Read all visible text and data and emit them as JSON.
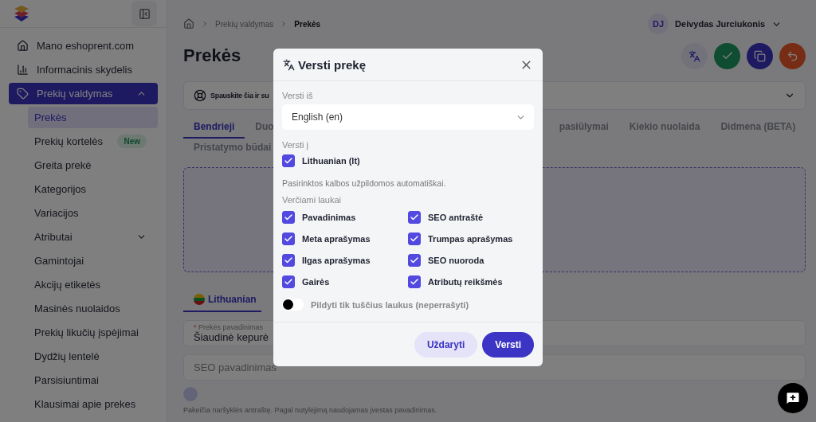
{
  "sidebar": {
    "items": [
      {
        "label": "Mano eshoprent.com",
        "selected": false,
        "kind": "link"
      },
      {
        "label": "Informacinis skydelis",
        "selected": false,
        "kind": "link"
      },
      {
        "label": "Prekių valdymas",
        "selected": true,
        "kind": "group",
        "expanded": true,
        "children": [
          {
            "label": "Prekės",
            "selected": true,
            "kind": "link"
          },
          {
            "label": "Prekių kortelės",
            "selected": false,
            "kind": "link",
            "badge": "New"
          },
          {
            "label": "Greita prekė",
            "selected": false,
            "kind": "link"
          },
          {
            "label": "Kategorijos",
            "selected": false,
            "kind": "link"
          },
          {
            "label": "Variacijos",
            "selected": false,
            "kind": "link"
          },
          {
            "label": "Atributai",
            "selected": false,
            "kind": "group",
            "expanded": false
          },
          {
            "label": "Gamintojai",
            "selected": false,
            "kind": "link"
          },
          {
            "label": "Akcijų etiketės",
            "selected": false,
            "kind": "link"
          },
          {
            "label": "Masinės nuolaidos",
            "selected": false,
            "kind": "link"
          },
          {
            "label": "Prekių likučių įspėjimai",
            "selected": false,
            "kind": "link"
          },
          {
            "label": "Dydžių lentelė",
            "selected": false,
            "kind": "link"
          },
          {
            "label": "Parsisiuntimai",
            "selected": false,
            "kind": "link"
          },
          {
            "label": "Klausimai apie prekes",
            "selected": false,
            "kind": "link"
          }
        ]
      }
    ]
  },
  "breadcrumb": [
    "Prekių valdymas",
    "Prekės"
  ],
  "user": {
    "initials": "DJ",
    "name": "Deivydas Jurciukonis"
  },
  "page_title": "Prekės",
  "help_bar": {
    "text": "Spauskite čia ir su"
  },
  "tabs": {
    "rows": [
      [
        {
          "label": "Bendrieji",
          "selected": true
        },
        {
          "label": "Duo",
          "selected": false
        },
        {
          "label": "pasiūlymai",
          "selected": false
        },
        {
          "label": "Kiekio nuolaida",
          "selected": false
        },
        {
          "label": "Didmena (BETA)",
          "selected": false
        }
      ],
      [
        {
          "label": "Pristatymo būdai",
          "selected": false
        }
      ]
    ]
  },
  "language_tabs": [
    {
      "label": "Lithuanian",
      "selected": true
    }
  ],
  "fields": [
    {
      "label": "Prekės pavadinimas",
      "required_mark": "*",
      "value": "Šiaudinė kepurė"
    },
    {
      "placeholder": "SEO pavadinimas"
    }
  ],
  "hint": "Pakeičia naršyklės antraštę. Pagal nutylėjimą naudojamas įvestas pavadinimas.",
  "modal": {
    "title": "Versti prekę",
    "from_label": "Versti iš",
    "from_value": "English (en)",
    "to_label": "Versti į",
    "targets": [
      {
        "label": "Lithuanian (lt)",
        "checked": true
      }
    ],
    "note": "Pasirinktos kalbos užpildomos automatiškai.",
    "fields_label": "Verčiami laukai",
    "fields": [
      {
        "label": "Pavadinimas",
        "checked": true
      },
      {
        "label": "SEO antraštė",
        "checked": true
      },
      {
        "label": "Meta aprašymas",
        "checked": true
      },
      {
        "label": "Trumpas aprašymas",
        "checked": true
      },
      {
        "label": "Ilgas aprašymas",
        "checked": true
      },
      {
        "label": "SEO nuoroda",
        "checked": true
      },
      {
        "label": "Gairės",
        "checked": true
      },
      {
        "label": "Atributų reikšmės",
        "checked": true
      }
    ],
    "toggle": {
      "label": "Pildyti tik tuščius laukus (neperrašyti)",
      "on": false
    },
    "buttons": [
      {
        "label": "Uždaryti",
        "kind": "secondary"
      },
      {
        "label": "Versti",
        "kind": "primary"
      }
    ]
  }
}
